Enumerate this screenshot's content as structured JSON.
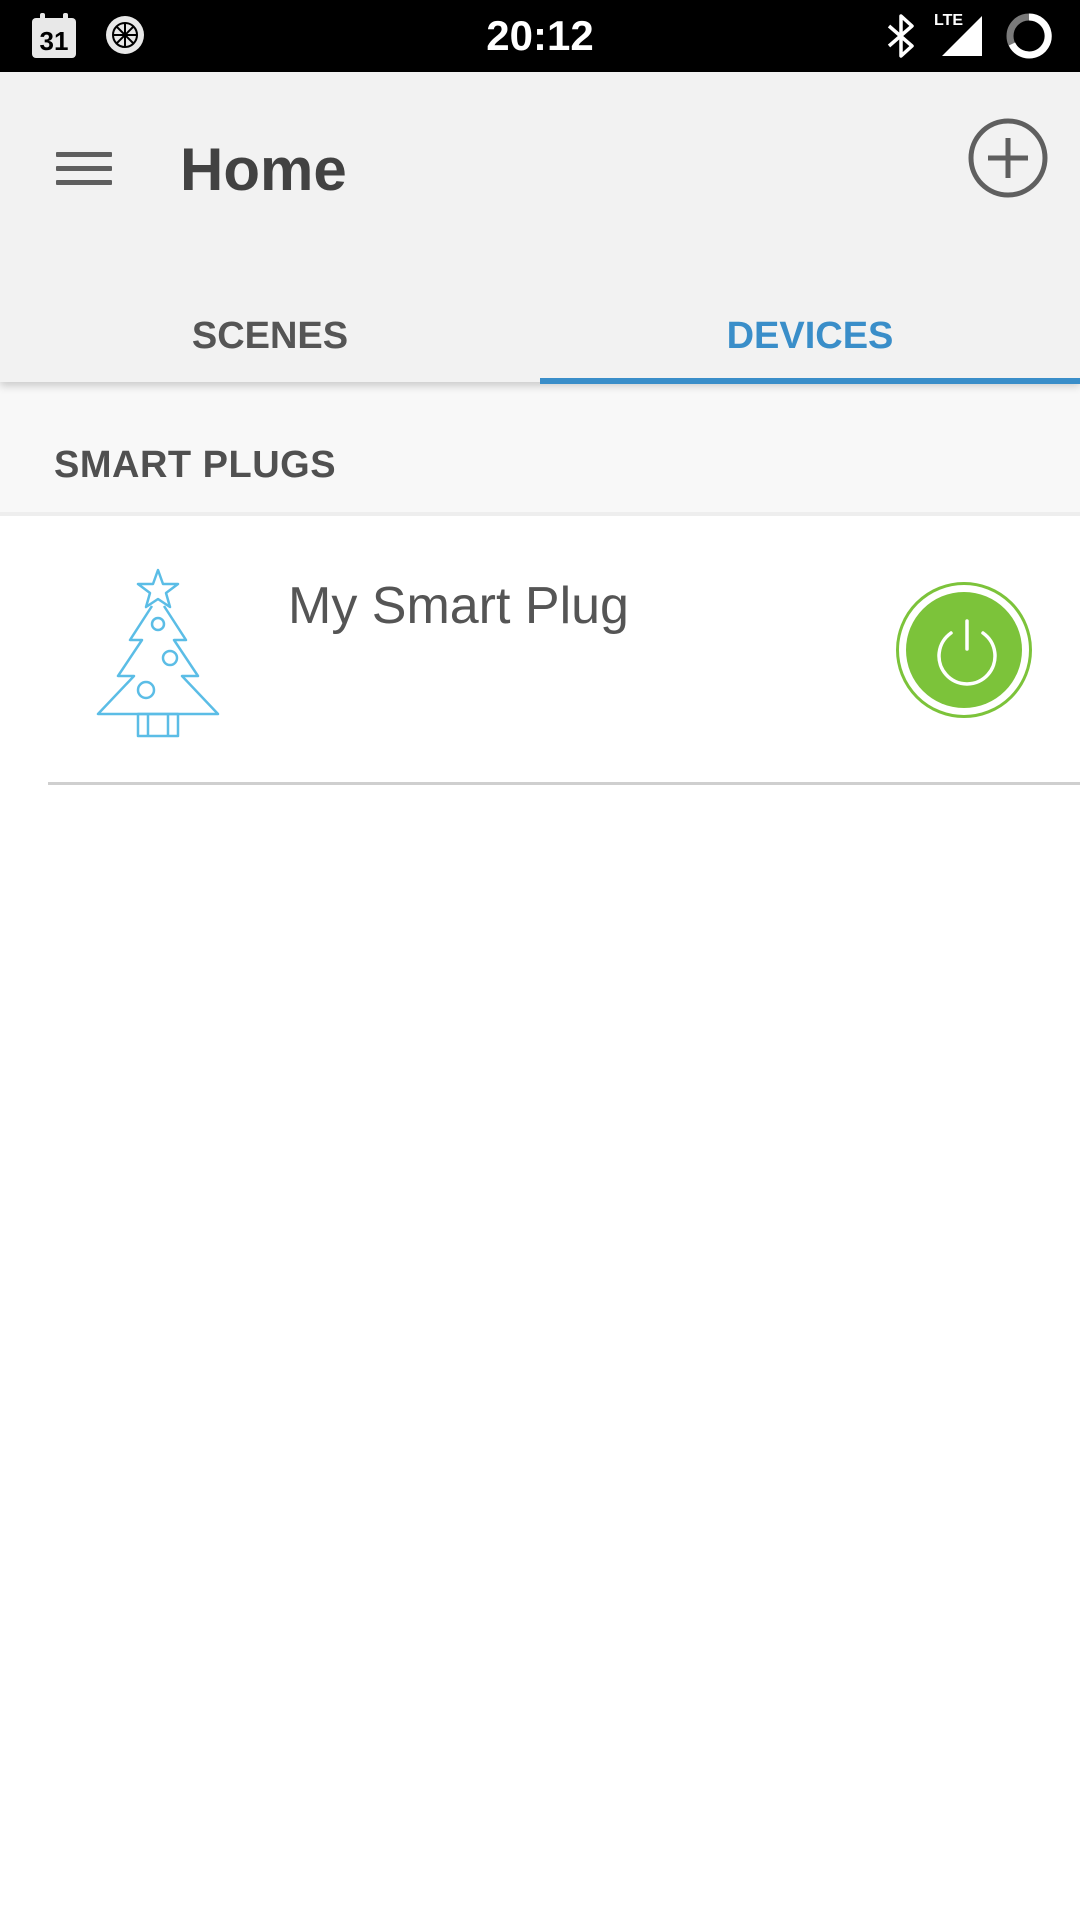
{
  "status_bar": {
    "time": "20:12",
    "calendar_day": "31",
    "network": "LTE",
    "icons": [
      "calendar-icon",
      "wheel-icon",
      "bluetooth-icon",
      "lte-signal-icon",
      "battery-icon"
    ]
  },
  "app_bar": {
    "title": "Home",
    "menu_icon": "menu-icon",
    "add_icon": "add-circle-icon"
  },
  "tabs": [
    {
      "label": "SCENES",
      "selected": false
    },
    {
      "label": "DEVICES",
      "selected": true
    }
  ],
  "section": {
    "title": "SMART PLUGS"
  },
  "devices": [
    {
      "name": "My Smart Plug",
      "icon": "christmas-tree-icon",
      "power_state": "on"
    }
  ],
  "colors": {
    "accent": "#3a8ec9",
    "power_on": "#7cc33a",
    "device_icon": "#5bbde6",
    "app_bar_bg": "#f2f2f2"
  }
}
